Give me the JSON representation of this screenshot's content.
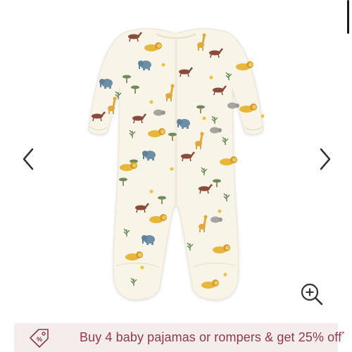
{
  "product": {
    "image_alt": "Safari print zip-up baby sleepsuit",
    "print_motifs": [
      "lion",
      "elephant",
      "giraffe",
      "zebra",
      "rhino",
      "acacia-tree",
      "palm-leaf",
      "sun"
    ]
  },
  "gallery": {
    "prev_icon": "chevron-left-icon",
    "next_icon": "chevron-right-icon",
    "zoom_icon": "zoom-in-icon"
  },
  "promo": {
    "icon": "price-tag-icon",
    "text": "Buy 4 baby pajamas or rompers & get 25% off",
    "asterisk": "*",
    "color": "#8b3a52",
    "background": "#f5ecec"
  },
  "colors": {
    "garment": "#f8f4e8",
    "lion": "#e7b73c",
    "elephant": "#6c8fa6",
    "zebra": "#8a4b3a",
    "leaf": "#6e8c5a",
    "rhino": "#a7a49d"
  }
}
